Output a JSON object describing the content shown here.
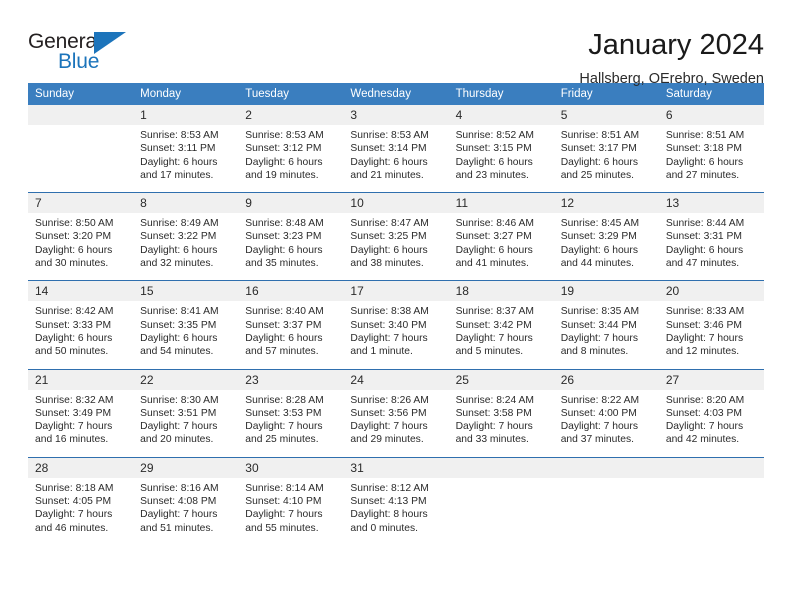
{
  "brand": {
    "name_part1": "General",
    "name_part2": "Blue",
    "triangle_color": "#1c74bb"
  },
  "header": {
    "title": "January 2024",
    "subtitle": "Hallsberg, OErebro, Sweden"
  },
  "theme": {
    "header_row_bg": "#3a7ebf",
    "week_divider": "#2f6fae",
    "daynum_bg": "#f0f0f0"
  },
  "weekdays": [
    "Sunday",
    "Monday",
    "Tuesday",
    "Wednesday",
    "Thursday",
    "Friday",
    "Saturday"
  ],
  "weeks": [
    [
      {
        "day": "",
        "sunrise": "",
        "sunset": "",
        "daylight": "",
        "daylight2": ""
      },
      {
        "day": "1",
        "sunrise": "Sunrise: 8:53 AM",
        "sunset": "Sunset: 3:11 PM",
        "daylight": "Daylight: 6 hours",
        "daylight2": "and 17 minutes."
      },
      {
        "day": "2",
        "sunrise": "Sunrise: 8:53 AM",
        "sunset": "Sunset: 3:12 PM",
        "daylight": "Daylight: 6 hours",
        "daylight2": "and 19 minutes."
      },
      {
        "day": "3",
        "sunrise": "Sunrise: 8:53 AM",
        "sunset": "Sunset: 3:14 PM",
        "daylight": "Daylight: 6 hours",
        "daylight2": "and 21 minutes."
      },
      {
        "day": "4",
        "sunrise": "Sunrise: 8:52 AM",
        "sunset": "Sunset: 3:15 PM",
        "daylight": "Daylight: 6 hours",
        "daylight2": "and 23 minutes."
      },
      {
        "day": "5",
        "sunrise": "Sunrise: 8:51 AM",
        "sunset": "Sunset: 3:17 PM",
        "daylight": "Daylight: 6 hours",
        "daylight2": "and 25 minutes."
      },
      {
        "day": "6",
        "sunrise": "Sunrise: 8:51 AM",
        "sunset": "Sunset: 3:18 PM",
        "daylight": "Daylight: 6 hours",
        "daylight2": "and 27 minutes."
      }
    ],
    [
      {
        "day": "7",
        "sunrise": "Sunrise: 8:50 AM",
        "sunset": "Sunset: 3:20 PM",
        "daylight": "Daylight: 6 hours",
        "daylight2": "and 30 minutes."
      },
      {
        "day": "8",
        "sunrise": "Sunrise: 8:49 AM",
        "sunset": "Sunset: 3:22 PM",
        "daylight": "Daylight: 6 hours",
        "daylight2": "and 32 minutes."
      },
      {
        "day": "9",
        "sunrise": "Sunrise: 8:48 AM",
        "sunset": "Sunset: 3:23 PM",
        "daylight": "Daylight: 6 hours",
        "daylight2": "and 35 minutes."
      },
      {
        "day": "10",
        "sunrise": "Sunrise: 8:47 AM",
        "sunset": "Sunset: 3:25 PM",
        "daylight": "Daylight: 6 hours",
        "daylight2": "and 38 minutes."
      },
      {
        "day": "11",
        "sunrise": "Sunrise: 8:46 AM",
        "sunset": "Sunset: 3:27 PM",
        "daylight": "Daylight: 6 hours",
        "daylight2": "and 41 minutes."
      },
      {
        "day": "12",
        "sunrise": "Sunrise: 8:45 AM",
        "sunset": "Sunset: 3:29 PM",
        "daylight": "Daylight: 6 hours",
        "daylight2": "and 44 minutes."
      },
      {
        "day": "13",
        "sunrise": "Sunrise: 8:44 AM",
        "sunset": "Sunset: 3:31 PM",
        "daylight": "Daylight: 6 hours",
        "daylight2": "and 47 minutes."
      }
    ],
    [
      {
        "day": "14",
        "sunrise": "Sunrise: 8:42 AM",
        "sunset": "Sunset: 3:33 PM",
        "daylight": "Daylight: 6 hours",
        "daylight2": "and 50 minutes."
      },
      {
        "day": "15",
        "sunrise": "Sunrise: 8:41 AM",
        "sunset": "Sunset: 3:35 PM",
        "daylight": "Daylight: 6 hours",
        "daylight2": "and 54 minutes."
      },
      {
        "day": "16",
        "sunrise": "Sunrise: 8:40 AM",
        "sunset": "Sunset: 3:37 PM",
        "daylight": "Daylight: 6 hours",
        "daylight2": "and 57 minutes."
      },
      {
        "day": "17",
        "sunrise": "Sunrise: 8:38 AM",
        "sunset": "Sunset: 3:40 PM",
        "daylight": "Daylight: 7 hours",
        "daylight2": "and 1 minute."
      },
      {
        "day": "18",
        "sunrise": "Sunrise: 8:37 AM",
        "sunset": "Sunset: 3:42 PM",
        "daylight": "Daylight: 7 hours",
        "daylight2": "and 5 minutes."
      },
      {
        "day": "19",
        "sunrise": "Sunrise: 8:35 AM",
        "sunset": "Sunset: 3:44 PM",
        "daylight": "Daylight: 7 hours",
        "daylight2": "and 8 minutes."
      },
      {
        "day": "20",
        "sunrise": "Sunrise: 8:33 AM",
        "sunset": "Sunset: 3:46 PM",
        "daylight": "Daylight: 7 hours",
        "daylight2": "and 12 minutes."
      }
    ],
    [
      {
        "day": "21",
        "sunrise": "Sunrise: 8:32 AM",
        "sunset": "Sunset: 3:49 PM",
        "daylight": "Daylight: 7 hours",
        "daylight2": "and 16 minutes."
      },
      {
        "day": "22",
        "sunrise": "Sunrise: 8:30 AM",
        "sunset": "Sunset: 3:51 PM",
        "daylight": "Daylight: 7 hours",
        "daylight2": "and 20 minutes."
      },
      {
        "day": "23",
        "sunrise": "Sunrise: 8:28 AM",
        "sunset": "Sunset: 3:53 PM",
        "daylight": "Daylight: 7 hours",
        "daylight2": "and 25 minutes."
      },
      {
        "day": "24",
        "sunrise": "Sunrise: 8:26 AM",
        "sunset": "Sunset: 3:56 PM",
        "daylight": "Daylight: 7 hours",
        "daylight2": "and 29 minutes."
      },
      {
        "day": "25",
        "sunrise": "Sunrise: 8:24 AM",
        "sunset": "Sunset: 3:58 PM",
        "daylight": "Daylight: 7 hours",
        "daylight2": "and 33 minutes."
      },
      {
        "day": "26",
        "sunrise": "Sunrise: 8:22 AM",
        "sunset": "Sunset: 4:00 PM",
        "daylight": "Daylight: 7 hours",
        "daylight2": "and 37 minutes."
      },
      {
        "day": "27",
        "sunrise": "Sunrise: 8:20 AM",
        "sunset": "Sunset: 4:03 PM",
        "daylight": "Daylight: 7 hours",
        "daylight2": "and 42 minutes."
      }
    ],
    [
      {
        "day": "28",
        "sunrise": "Sunrise: 8:18 AM",
        "sunset": "Sunset: 4:05 PM",
        "daylight": "Daylight: 7 hours",
        "daylight2": "and 46 minutes."
      },
      {
        "day": "29",
        "sunrise": "Sunrise: 8:16 AM",
        "sunset": "Sunset: 4:08 PM",
        "daylight": "Daylight: 7 hours",
        "daylight2": "and 51 minutes."
      },
      {
        "day": "30",
        "sunrise": "Sunrise: 8:14 AM",
        "sunset": "Sunset: 4:10 PM",
        "daylight": "Daylight: 7 hours",
        "daylight2": "and 55 minutes."
      },
      {
        "day": "31",
        "sunrise": "Sunrise: 8:12 AM",
        "sunset": "Sunset: 4:13 PM",
        "daylight": "Daylight: 8 hours",
        "daylight2": "and 0 minutes."
      },
      {
        "day": "",
        "sunrise": "",
        "sunset": "",
        "daylight": "",
        "daylight2": ""
      },
      {
        "day": "",
        "sunrise": "",
        "sunset": "",
        "daylight": "",
        "daylight2": ""
      },
      {
        "day": "",
        "sunrise": "",
        "sunset": "",
        "daylight": "",
        "daylight2": ""
      }
    ]
  ]
}
